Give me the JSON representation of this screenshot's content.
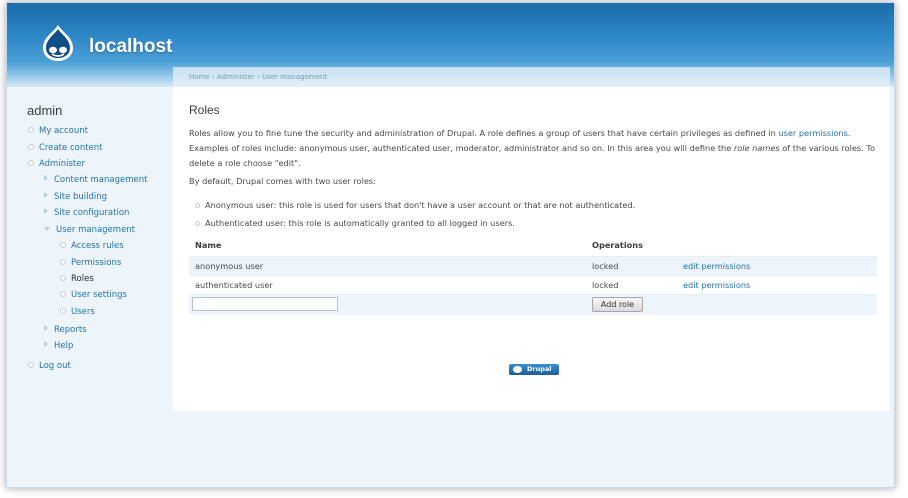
{
  "header": {
    "site_name": "localhost",
    "logo_icon": "drupal-drop-icon"
  },
  "breadcrumb": "Home › Administer › User management",
  "sidebar": {
    "title": "admin",
    "items": [
      {
        "label": "My account",
        "level": 0,
        "marker": "bullet"
      },
      {
        "label": "Create content",
        "level": 0,
        "marker": "bullet"
      },
      {
        "label": "Administer",
        "level": 0,
        "marker": "bullet"
      },
      {
        "label": "Content management",
        "level": 1,
        "marker": "collapsed"
      },
      {
        "label": "Site building",
        "level": 1,
        "marker": "collapsed"
      },
      {
        "label": "Site configuration",
        "level": 1,
        "marker": "collapsed"
      },
      {
        "label": "User management",
        "level": 1,
        "marker": "expanded"
      },
      {
        "label": "Access rules",
        "level": 2,
        "marker": "bullet"
      },
      {
        "label": "Permissions",
        "level": 2,
        "marker": "bullet"
      },
      {
        "label": "Roles",
        "level": 2,
        "marker": "bullet",
        "active": true
      },
      {
        "label": "User settings",
        "level": 2,
        "marker": "bullet"
      },
      {
        "label": "Users",
        "level": 2,
        "marker": "bullet"
      },
      {
        "label": "Reports",
        "level": 1,
        "marker": "collapsed"
      },
      {
        "label": "Help",
        "level": 1,
        "marker": "collapsed"
      },
      {
        "label": "Log out",
        "level": 0,
        "marker": "bullet"
      }
    ]
  },
  "main": {
    "title": "Roles",
    "intro_part1": "Roles allow you to fine tune the security and administration of Drupal. A role defines a group of users that have certain privileges as defined in ",
    "intro_link": "user permissions",
    "intro_part2": ". Examples of roles include: anonymous user, authenticated user, moderator, administrator and so on. In this area you will define the ",
    "intro_em": "role names",
    "intro_part3": " of the various roles. To delete a role choose \"edit\".",
    "default_text": "By default, Drupal comes with two user roles:",
    "role_descriptions": [
      "Anonymous user: this role is used for users that don't have a user account or that are not authenticated.",
      "Authenticated user: this role is automatically granted to all logged in users."
    ],
    "table": {
      "headers": {
        "name": "Name",
        "operations": "Operations"
      },
      "rows": [
        {
          "name": "anonymous user",
          "status": "locked",
          "action": "edit permissions"
        },
        {
          "name": "authenticated user",
          "status": "locked",
          "action": "edit permissions"
        }
      ],
      "new_role_value": "",
      "add_button": "Add role"
    }
  },
  "footer": {
    "powered_by": "Drupal"
  },
  "colors": {
    "link": "#1f71b1",
    "header_blue": "#2f88c7",
    "page_bg": "#edf5fa"
  }
}
